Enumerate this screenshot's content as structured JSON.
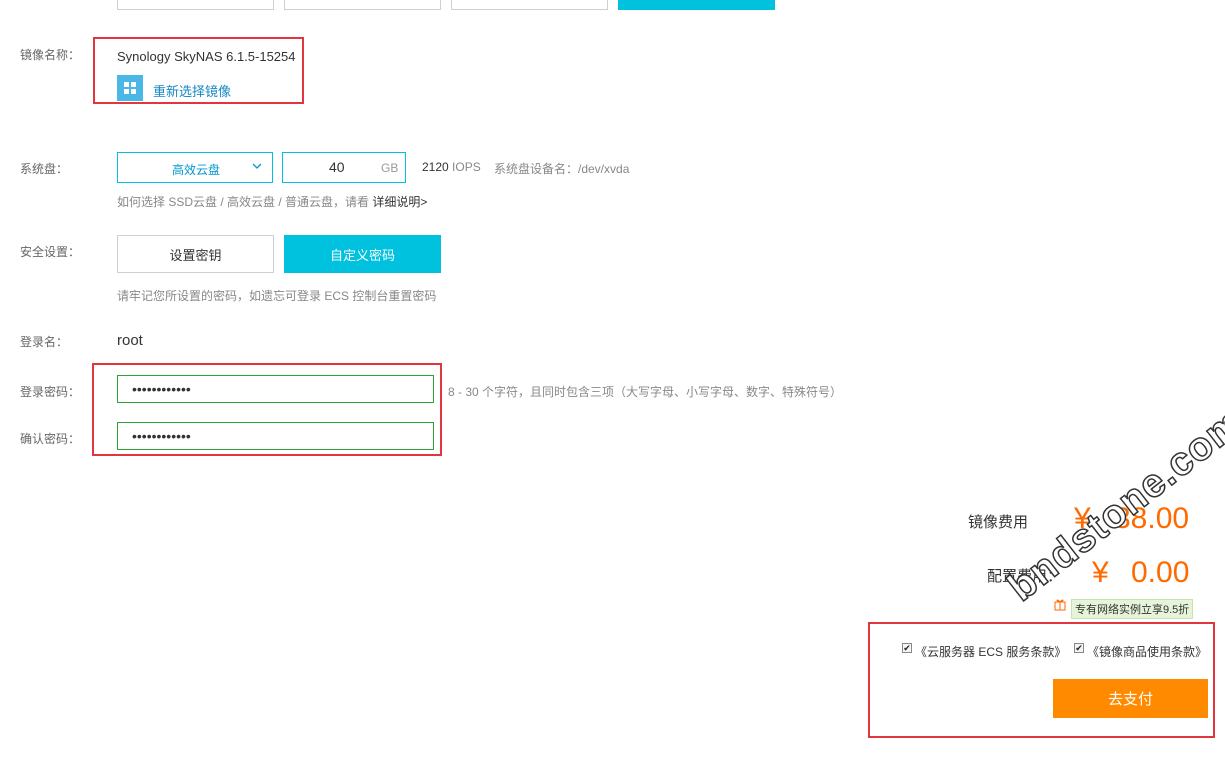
{
  "image": {
    "label": "镜像名称：",
    "name": "Synology SkyNAS 6.1.5-15254",
    "reselect": "重新选择镜像"
  },
  "system_disk": {
    "label": "系统盘：",
    "type": "高效云盘",
    "size": "40",
    "unit": "GB",
    "iops_value": "2120",
    "iops_unit": "IOPS",
    "device": "系统盘设备名：/dev/xvda",
    "hint_prefix": "如何选择 SSD云盘 / 高效云盘 / 普通云盘，请看",
    "hint_link": "详细说明>"
  },
  "security": {
    "label": "安全设置：",
    "btn_key": "设置密钥",
    "btn_password": "自定义密码",
    "hint": "请牢记您所设置的密码，如遗忘可登录 ECS 控制台重置密码"
  },
  "login": {
    "label": "登录名：",
    "name": "root",
    "password_label": "登录密码：",
    "password_value": "••••••••••••",
    "password_hint": "8 - 30 个字符，且同时包含三项（大写字母、小写字母、数字、特殊符号）",
    "confirm_label": "确认密码：",
    "confirm_value": "••••••••••••"
  },
  "fees": {
    "image_label": "镜像费用",
    "image_currency": "¥",
    "image_amount": "38.00",
    "config_label": "配置费用：",
    "config_currency": "¥",
    "config_amount": "0.00",
    "promo": "专有网络实例立享9.5折"
  },
  "terms": {
    "ecs": "《云服务器 ECS 服务条款》",
    "image": "《镜像商品使用条款》",
    "ecs_checked": true,
    "image_checked": true
  },
  "pay_button": "去支付",
  "watermark": "bndstone.com",
  "colors": {
    "accent": "#00c1de",
    "price": "#ff6a00",
    "pay": "#ff8a00",
    "highlight_box": "#e2353d",
    "valid": "#2aa435"
  }
}
